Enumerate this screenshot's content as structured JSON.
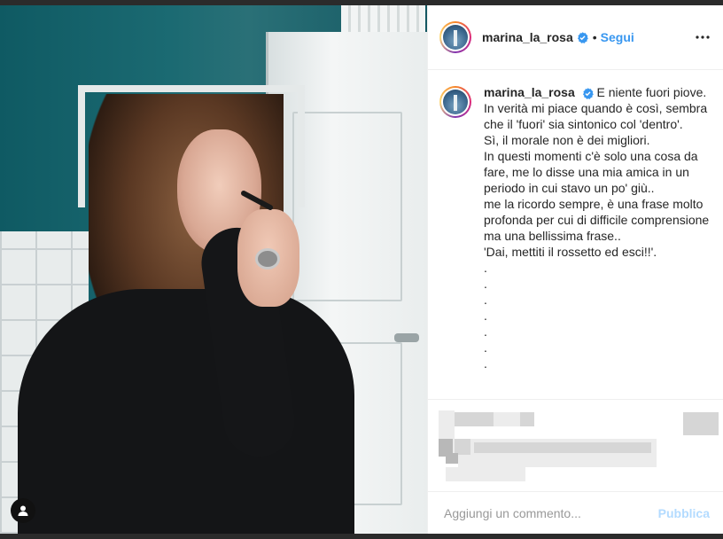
{
  "post": {
    "username": "marina_la_rosa",
    "separator": "•",
    "follow_label": "Segui",
    "more_icon": "more-horizontal-icon",
    "verified_icon": "verified-badge-icon"
  },
  "caption": {
    "username": "marina_la_rosa",
    "text": "E niente fuori piove.\nIn verità mi piace quando è così, sembra che il 'fuori' sia sintonico col 'dentro'.\nSì, il morale non è dei migliori.\nIn questi momenti c'è solo una cosa da fare, me lo disse una mia amica in un periodo in cui stavo un po' giù..\nme la ricordo sempre, è una frase molto profonda per cui di difficile comprensione ma una bellissima frase..\n'Dai, mettiti il rossetto ed esci!!'.\n.\n.\n.\n.\n.\n.\n."
  },
  "comment": {
    "placeholder": "Aggiungi un commento...",
    "publish_label": "Pubblica"
  },
  "colors": {
    "accent": "#3897f0",
    "publish_disabled": "#b3dbff",
    "text": "#262626",
    "placeholder": "#999999"
  }
}
